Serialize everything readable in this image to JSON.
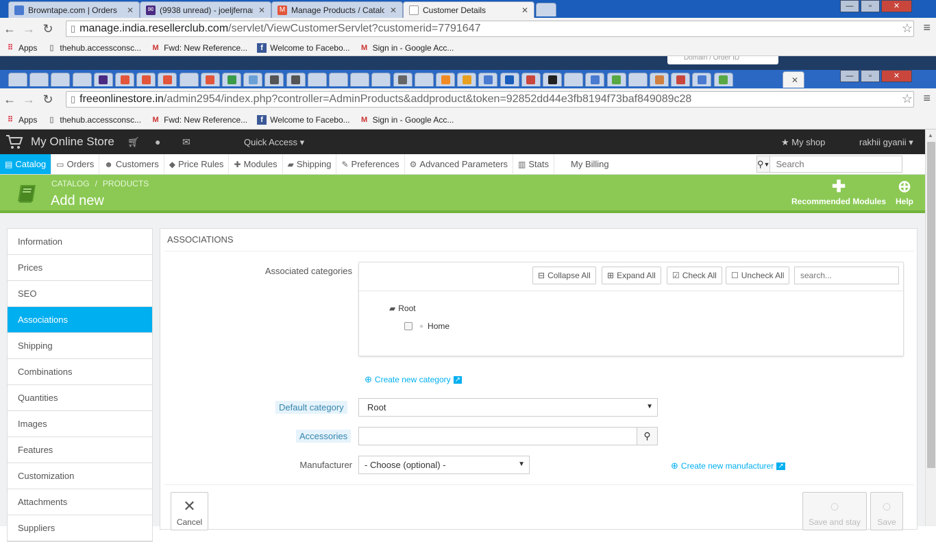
{
  "browser1": {
    "tabs": [
      {
        "title": "Browntape.com | Orders",
        "color": "#4a7bd1"
      },
      {
        "title": "(9938 unread) - joeljfernan",
        "color": "#4b2a82"
      },
      {
        "title": "Manage Products / Catalog",
        "color": "#e2563b"
      },
      {
        "title": "Customer Details",
        "color": "#888888"
      }
    ],
    "url_domain": "manage.india.resellerclub.com",
    "url_path": "/servlet/ViewCustomerServlet?customerid=7791647",
    "domain_order_hint": "Domain / Order ID"
  },
  "bookmarks": [
    {
      "label": "Apps",
      "icon": "apps-icon"
    },
    {
      "label": "thehub.accessconsc...",
      "icon": "page-icon"
    },
    {
      "label": "Fwd: New Reference...",
      "icon": "gmail-icon"
    },
    {
      "label": "Welcome to Facebo...",
      "icon": "facebook-icon"
    },
    {
      "label": "Sign in - Google Acc...",
      "icon": "gmail-icon"
    }
  ],
  "browser2": {
    "url_domain": "freeonlinestore.in",
    "url_path": "/admin2954/index.php?controller=AdminProducts&addproduct&token=92852dd44e3fb8194f73baf849089c28",
    "mini_tab_colors": [
      "#c9d6ea",
      "#c9d6ea",
      "#c9d6ea",
      "#c9d6ea",
      "#4b2a82",
      "#e2563b",
      "#e2563b",
      "#e2563b",
      "#c9d6ea",
      "#e2563b",
      "#3a9b4a",
      "#6aa0d6",
      "#555",
      "#555",
      "#c9d6ea",
      "#c9d6ea",
      "#c9d6ea",
      "#c9d6ea",
      "#666",
      "#c9d6ea",
      "#f08a24",
      "#e8a020",
      "#4a7bd1",
      "#1a5dbb",
      "#c9463d",
      "#222",
      "#c9d6ea",
      "#4a7bd1",
      "#58a844",
      "#c9d6ea",
      "#d08040",
      "#c9463d",
      "#4a7bd1",
      "#58a844"
    ]
  },
  "ps_header": {
    "brand": "My Online Store",
    "quick_access": "Quick Access",
    "my_shop": "My shop",
    "user": "rakhii gyanii"
  },
  "ps_nav": [
    {
      "label": "Catalog",
      "icon": "book-icon",
      "glyph": "▤",
      "active": true
    },
    {
      "label": "Orders",
      "icon": "orders-icon",
      "glyph": "▭",
      "active": false
    },
    {
      "label": "Customers",
      "icon": "users-icon",
      "glyph": "☻",
      "active": false
    },
    {
      "label": "Price Rules",
      "icon": "tag-icon",
      "glyph": "◆",
      "active": false
    },
    {
      "label": "Modules",
      "icon": "puzzle-icon",
      "glyph": "✚",
      "active": false
    },
    {
      "label": "Shipping",
      "icon": "truck-icon",
      "glyph": "▰",
      "active": false
    },
    {
      "label": "Preferences",
      "icon": "wrench-icon",
      "glyph": "✎",
      "active": false
    },
    {
      "label": "Advanced Parameters",
      "icon": "cogs-icon",
      "glyph": "⚙",
      "active": false
    },
    {
      "label": "Stats",
      "icon": "chart-icon",
      "glyph": "▥",
      "active": false
    },
    {
      "label": "My Billing",
      "icon": "",
      "glyph": "",
      "active": false
    }
  ],
  "search": {
    "placeholder": "Search"
  },
  "page": {
    "breadcrumb": [
      "CATALOG",
      "/",
      "PRODUCTS"
    ],
    "title": "Add new",
    "recommended": "Recommended Modules",
    "help": "Help"
  },
  "sidebar": [
    {
      "label": "Information",
      "active": false
    },
    {
      "label": "Prices",
      "active": false
    },
    {
      "label": "SEO",
      "active": false
    },
    {
      "label": "Associations",
      "active": true
    },
    {
      "label": "Shipping",
      "active": false
    },
    {
      "label": "Combinations",
      "active": false
    },
    {
      "label": "Quantities",
      "active": false
    },
    {
      "label": "Images",
      "active": false
    },
    {
      "label": "Features",
      "active": false
    },
    {
      "label": "Customization",
      "active": false
    },
    {
      "label": "Attachments",
      "active": false
    },
    {
      "label": "Suppliers",
      "active": false
    }
  ],
  "associations": {
    "heading": "Associations",
    "categories_label": "Associated categories",
    "collapse_all": "Collapse All",
    "expand_all": "Expand All",
    "check_all": "Check All",
    "uncheck_all": "Uncheck All",
    "tree_search_placeholder": "search...",
    "root": "Root",
    "home": "Home",
    "create_category": "Create new category",
    "default_category_label": "Default category",
    "default_category_value": "Root",
    "accessories_label": "Accessories",
    "manufacturer_label": "Manufacturer",
    "manufacturer_value": "- Choose (optional) -",
    "create_manufacturer": "Create new manufacturer"
  },
  "footer": {
    "cancel": "Cancel",
    "save_stay": "Save and stay",
    "save": "Save"
  }
}
